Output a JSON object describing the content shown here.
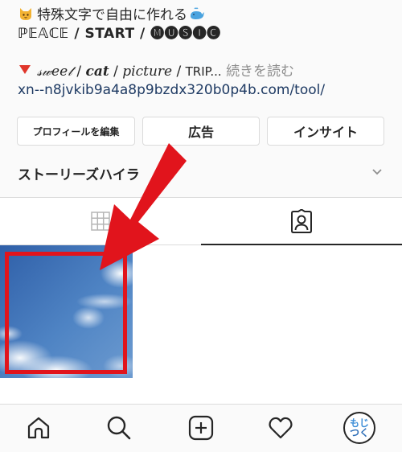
{
  "bio": {
    "line1": "特殊文字で自由に作れる",
    "line2": "ℙ𝔼𝔸ℂ𝔼 / START / 🅜🅤🅢🅘🅒",
    "line3_sweet": "𝓈𝓌𝑒𝑒𝓉",
    "line3_cat": "cat",
    "line3_picture": "picture",
    "line3_trip": "TRIP...",
    "more_label": "続きを読む",
    "separator": " / ",
    "link": "xn--n8jvkib9a4a8p9bzdx320b0p4b.com/tool/"
  },
  "buttons": {
    "edit_profile": "プロフィールを編集",
    "ad": "広告",
    "insight": "インサイト"
  },
  "highlights": {
    "label": "ストーリーズハイラ"
  },
  "tabs": [
    {
      "name": "grid",
      "icon": "grid-icon",
      "active": false
    },
    {
      "name": "tagged",
      "icon": "tagged-icon",
      "active": true
    }
  ],
  "bottom_nav": [
    {
      "name": "home",
      "icon": "home-icon"
    },
    {
      "name": "search",
      "icon": "search-icon"
    },
    {
      "name": "new-post",
      "icon": "plus-square-icon"
    },
    {
      "name": "activity",
      "icon": "heart-icon"
    },
    {
      "name": "profile",
      "icon": "avatar"
    }
  ],
  "avatar": {
    "line1": "もじ",
    "line2": "つく"
  },
  "colors": {
    "link": "#1e3a63",
    "annotation_red": "#e1141c",
    "border": "#dbdbdb",
    "text": "#262626"
  }
}
